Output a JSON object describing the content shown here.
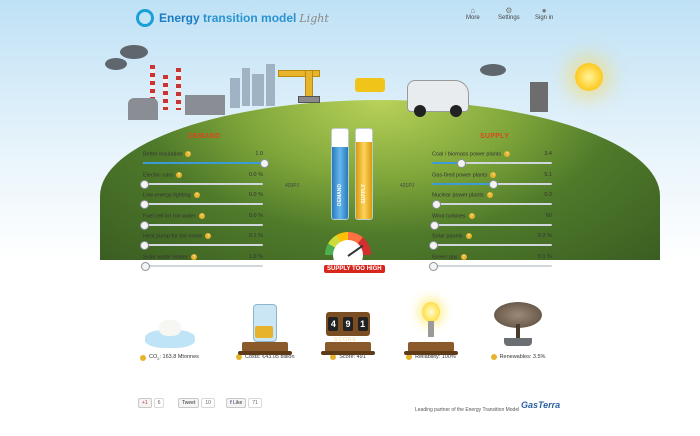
{
  "app": {
    "title_part1": "Energy",
    "title_part2": "transition model",
    "title_suffix": "Light"
  },
  "nav": {
    "more": "More",
    "settings": "Settings",
    "sign_in": "Sign in"
  },
  "demand": {
    "title": "DEMAND",
    "sliders": [
      {
        "label": "Better insulation",
        "value": "1.0",
        "fraction": 1.0
      },
      {
        "label": "Electric cars",
        "value": "0.0 %",
        "fraction": 0.0
      },
      {
        "label": "Low-energy lighting",
        "value": "0.0 %",
        "fraction": 0.0
      },
      {
        "label": "Fuel cell for hot water",
        "value": "0.0 %",
        "fraction": 0.0
      },
      {
        "label": "Heat pump for the home",
        "value": "0.1 %",
        "fraction": 0.001
      },
      {
        "label": "Solar water heater",
        "value": "1.0 %",
        "fraction": 0.01
      }
    ]
  },
  "supply": {
    "title": "SUPPLY",
    "sliders": [
      {
        "label": "Coal / biomass power plants",
        "value": "3.4",
        "fraction": 0.24
      },
      {
        "label": "Gas-fired power plants",
        "value": "5.1",
        "fraction": 0.5
      },
      {
        "label": "Nuclear power plants",
        "value": "0.3",
        "fraction": 0.03
      },
      {
        "label": "Wind turbines",
        "value": "60",
        "fraction": 0.01
      },
      {
        "label": "Solar panels",
        "value": "0.2 %",
        "fraction": 0.002
      },
      {
        "label": "Green gas",
        "value": "0.1 %",
        "fraction": 0.001
      }
    ]
  },
  "balance": {
    "demand_pj": "403PJ",
    "supply_pj": "431PJ",
    "demand_label": "DEMAND",
    "supply_label": "SUPPLY",
    "demand_level": 0.8,
    "supply_level": 0.86,
    "status": "SUPPLY TOO HIGH"
  },
  "dashboard": {
    "co2_label": "CO",
    "co2_sub": "2",
    "co2_value": ": 163.8 Mtonnes",
    "costs": "Costs: €43.05 billion",
    "score": "Score: 491",
    "score_digits": [
      "4",
      "9",
      "1"
    ],
    "score_word": "SCORE",
    "reliability": "Reliability: 100%",
    "renewables": "Renewables: 3.5%"
  },
  "social": {
    "gplus_label": "+1",
    "gplus_count": "6",
    "tweet_label": "Tweet",
    "tweet_count": "10",
    "like_label": "Like",
    "like_count": "71"
  },
  "footer": {
    "partner_text": "Leading partner of the Energy Transition Model",
    "partner_name": "GasTerra"
  },
  "colors": {
    "accent": "#d64a1a",
    "slider_fill": "#3d9ad8",
    "demand_meter": "#3b8fd0",
    "supply_meter": "#f0b323",
    "status_badge": "#d7261b"
  }
}
